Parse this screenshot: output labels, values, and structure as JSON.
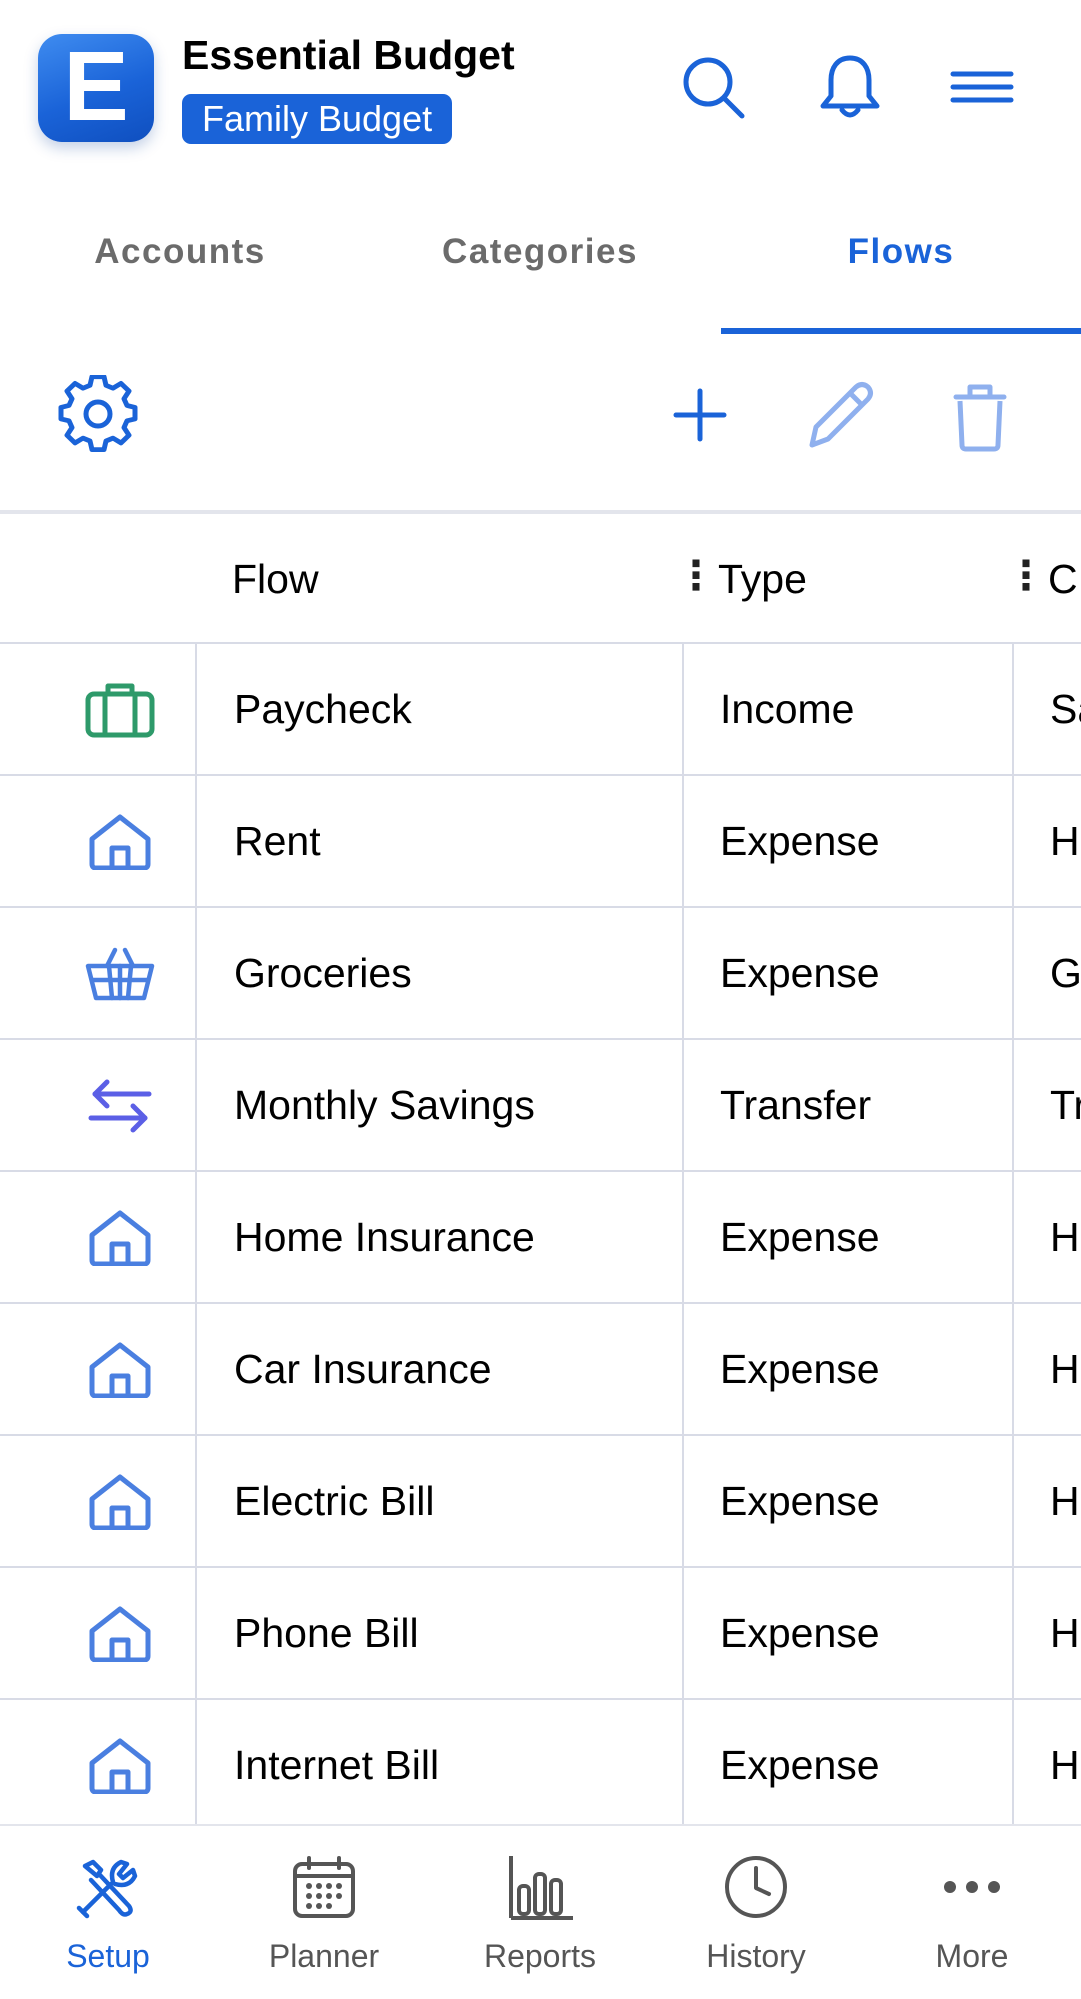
{
  "colors": {
    "accent": "#1a63d8",
    "income_icon": "#2e9a6a",
    "expense_icon": "#4a7fe0",
    "transfer_icon": "#5b5fe6",
    "disabled_tool": "#8fb0ee",
    "muted_text": "#6b6b6b"
  },
  "header": {
    "logo_letter": "E",
    "app_title": "Essential Budget",
    "budget_name": "Family Budget",
    "icons": [
      "search-icon",
      "bell-icon",
      "menu-icon"
    ]
  },
  "tabs": [
    {
      "label": "Accounts",
      "active": false
    },
    {
      "label": "Categories",
      "active": false
    },
    {
      "label": "Flows",
      "active": true
    }
  ],
  "toolbar": {
    "icons": [
      "gear-icon",
      "plus-icon",
      "pencil-icon",
      "trash-icon"
    ]
  },
  "table": {
    "columns": [
      "Flow",
      "Type",
      "C"
    ],
    "rows": [
      {
        "icon": "briefcase-icon",
        "flow": "Paycheck",
        "type": "Income",
        "category": "Sa"
      },
      {
        "icon": "house-icon",
        "flow": "Rent",
        "type": "Expense",
        "category": "H"
      },
      {
        "icon": "basket-icon",
        "flow": "Groceries",
        "type": "Expense",
        "category": "G"
      },
      {
        "icon": "transfer-arrows-icon",
        "flow": "Monthly Savings",
        "type": "Transfer",
        "category": "Tr"
      },
      {
        "icon": "house-icon",
        "flow": "Home Insurance",
        "type": "Expense",
        "category": "H"
      },
      {
        "icon": "house-icon",
        "flow": "Car Insurance",
        "type": "Expense",
        "category": "H"
      },
      {
        "icon": "house-icon",
        "flow": "Electric Bill",
        "type": "Expense",
        "category": "H"
      },
      {
        "icon": "house-icon",
        "flow": "Phone Bill",
        "type": "Expense",
        "category": "H"
      },
      {
        "icon": "house-icon",
        "flow": "Internet Bill",
        "type": "Expense",
        "category": "H"
      }
    ]
  },
  "bottom_nav": [
    {
      "label": "Setup",
      "icon": "tools-icon",
      "active": true
    },
    {
      "label": "Planner",
      "icon": "calendar-icon",
      "active": false
    },
    {
      "label": "Reports",
      "icon": "bar-chart-icon",
      "active": false
    },
    {
      "label": "History",
      "icon": "clock-icon",
      "active": false
    },
    {
      "label": "More",
      "icon": "more-icon",
      "active": false
    }
  ]
}
